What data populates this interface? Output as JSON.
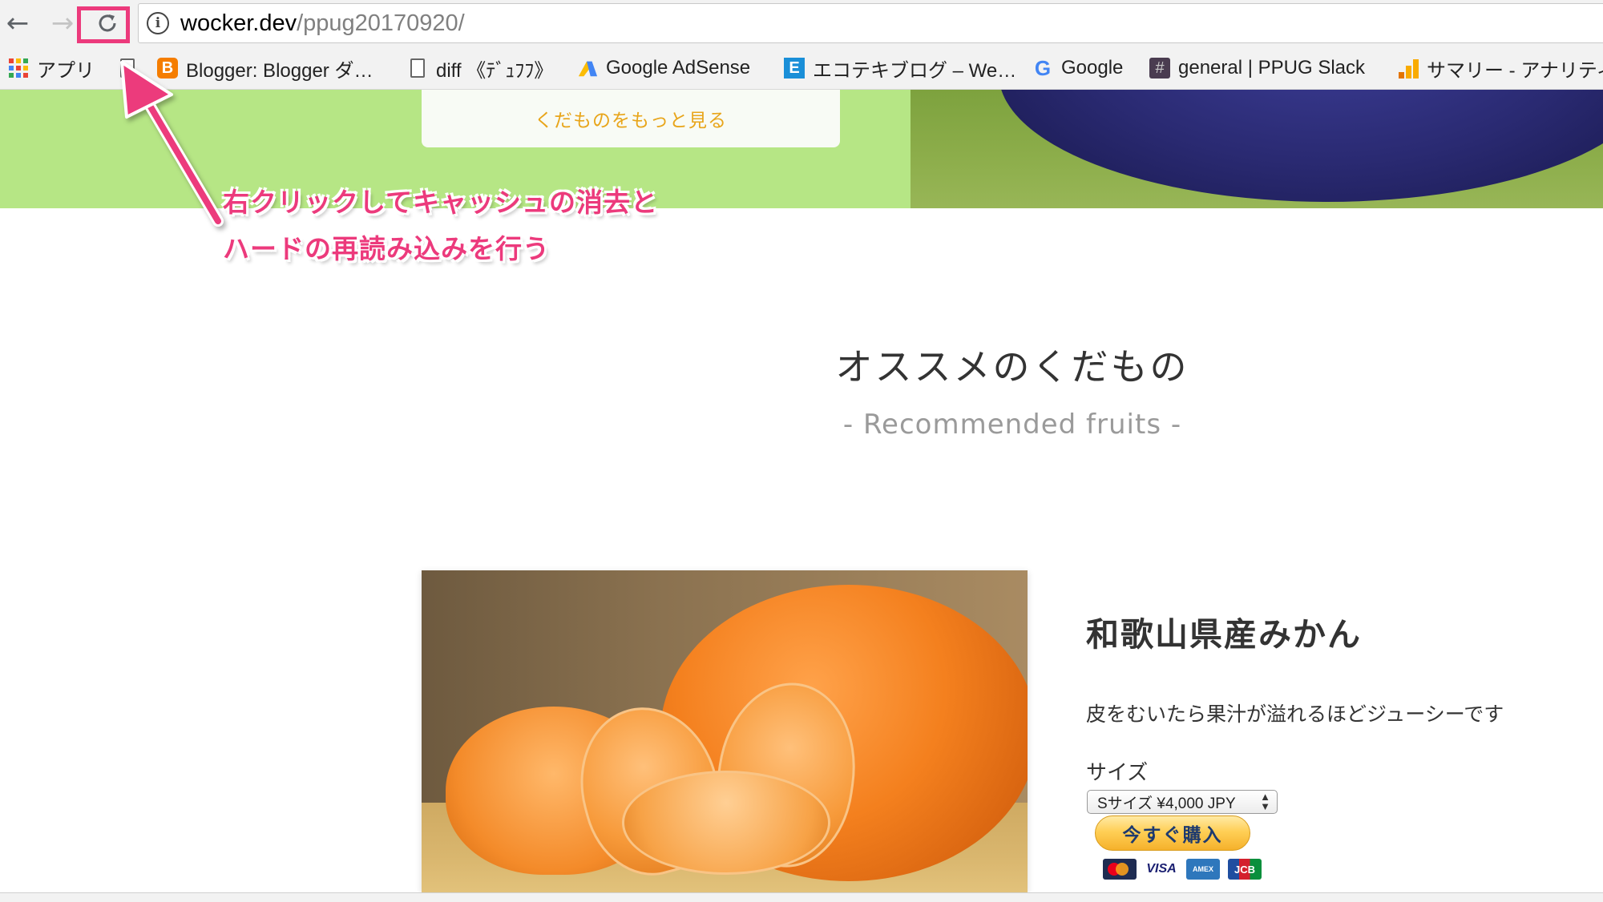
{
  "browser": {
    "url_host": "wocker.dev",
    "url_path": "/ppug20170920/",
    "nav_icons": [
      "back-arrow-icon",
      "forward-arrow-icon",
      "reload-icon"
    ],
    "highlight_color": "#ec3a7c"
  },
  "bookmarks": [
    {
      "label": "アプリ",
      "icon": "apps-grid-icon"
    },
    {
      "label": "",
      "icon": "page-icon"
    },
    {
      "label": "Blogger: Blogger ダ…",
      "icon": "blogger-icon"
    },
    {
      "label": "diff 《ﾃﾞｭﾌﾌ》",
      "icon": "page-icon"
    },
    {
      "label": "Google AdSense",
      "icon": "adsense-icon"
    },
    {
      "label": "エコテキブログ – We…",
      "icon": "e-icon"
    },
    {
      "label": "Google",
      "icon": "google-icon"
    },
    {
      "label": "general | PPUG Slack",
      "icon": "slack-hash-icon"
    },
    {
      "label": "サマリー - アナリティ",
      "icon": "analytics-icon"
    }
  ],
  "hero": {
    "more_button": "くだものをもっと見る",
    "green_color": "#b6e685",
    "button_text_color": "#e8a51a"
  },
  "annotation": {
    "line1": "右クリックしてキャッシュの消去と",
    "line2": "ハードの再読み込みを行う",
    "color": "#ec3a7c"
  },
  "section": {
    "title": "オススメのくだもの",
    "subtitle": "- Recommended fruits -"
  },
  "product": {
    "name": "和歌山県産みかん",
    "description": "皮をむいたら果汁が溢れるほどジューシーです",
    "size_label": "サイズ",
    "size_selected": "Sサイズ ¥4,000 JPY",
    "buy_label": "今すぐ購入",
    "cards": [
      "MasterCard",
      "VISA",
      "AMEX",
      "JCB"
    ]
  }
}
